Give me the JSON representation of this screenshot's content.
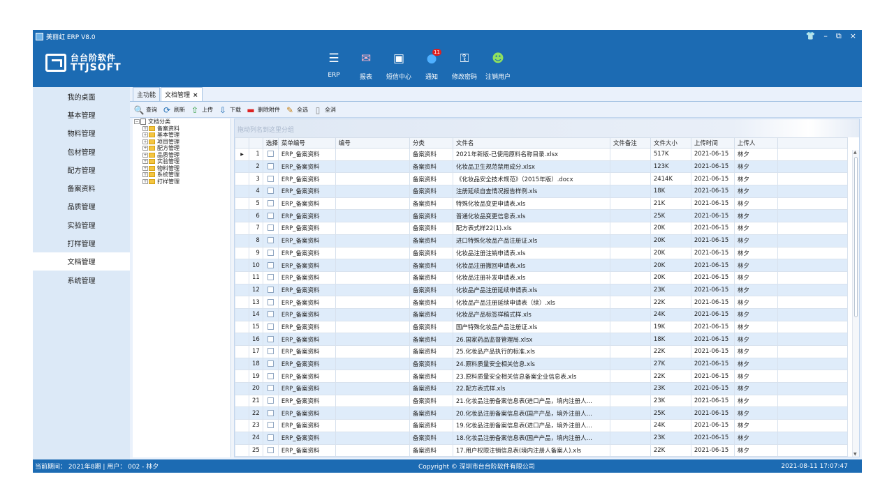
{
  "window": {
    "title": "美丽虹 ERP V8.0"
  },
  "logo": {
    "cn": "台台阶软件",
    "en": "TTJSOFT"
  },
  "topnav": [
    {
      "label": "ERP",
      "icon": "erp-icon"
    },
    {
      "label": "报表",
      "icon": "report-icon"
    },
    {
      "label": "短信中心",
      "icon": "sms-icon"
    },
    {
      "label": "通知",
      "icon": "notification-icon",
      "badge": "11"
    },
    {
      "label": "修改密码",
      "icon": "key-icon"
    },
    {
      "label": "注销用户",
      "icon": "logout-user-icon"
    }
  ],
  "sidebar": [
    "我的桌面",
    "基本管理",
    "物料管理",
    "包材管理",
    "配方管理",
    "备案资料",
    "品质管理",
    "实验管理",
    "打样管理",
    "文档管理",
    "系统管理"
  ],
  "sidebar_active": "文档管理",
  "tabs": {
    "main": "主功能",
    "doc": "文档管理",
    "close": "×"
  },
  "toolbar": {
    "query": "查询",
    "refresh": "刷新",
    "upload": "上传",
    "download": "下载",
    "delete": "删除附件",
    "selectall": "全选",
    "deselect": "全消"
  },
  "tree": {
    "root": "文档分类",
    "children": [
      "备案资料",
      "基本管理",
      "项目管理",
      "配方管理",
      "品质管理",
      "实验管理",
      "物料管理",
      "系统管理",
      "打样管理"
    ]
  },
  "grid": {
    "group_hint": "拖动列名到这里分组",
    "headers": [
      "选择",
      "菜单编号",
      "编号",
      "分类",
      "文件名",
      "文件备注",
      "文件大小",
      "上传时间",
      "上传人"
    ],
    "rows": [
      {
        "n": "1",
        "menu": "ERP_备案资料",
        "code": "",
        "cat": "备案资料",
        "file": "2021年新版-已使用原料名称目录.xlsx",
        "note": "",
        "size": "517K",
        "date": "2021-06-15",
        "user": "林夕"
      },
      {
        "n": "2",
        "menu": "ERP_备案资料",
        "code": "",
        "cat": "备案资料",
        "file": "化妆品卫生规范禁用成分.xlsx",
        "note": "",
        "size": "123K",
        "date": "2021-06-15",
        "user": "林夕"
      },
      {
        "n": "3",
        "menu": "ERP_备案资料",
        "code": "",
        "cat": "备案资料",
        "file": "《化妆品安全技术规范》（2015年版）.docx",
        "note": "",
        "size": "2414K",
        "date": "2021-06-15",
        "user": "林夕"
      },
      {
        "n": "4",
        "menu": "ERP_备案资料",
        "code": "",
        "cat": "备案资料",
        "file": "注册延续自查情况报告样例.xls",
        "note": "",
        "size": "18K",
        "date": "2021-06-15",
        "user": "林夕"
      },
      {
        "n": "5",
        "menu": "ERP_备案资料",
        "code": "",
        "cat": "备案资料",
        "file": "特殊化妆品变更申请表.xls",
        "note": "",
        "size": "21K",
        "date": "2021-06-15",
        "user": "林夕"
      },
      {
        "n": "6",
        "menu": "ERP_备案资料",
        "code": "",
        "cat": "备案资料",
        "file": "普通化妆品变更信息表.xls",
        "note": "",
        "size": "25K",
        "date": "2021-06-15",
        "user": "林夕"
      },
      {
        "n": "7",
        "menu": "ERP_备案资料",
        "code": "",
        "cat": "备案资料",
        "file": "配方表式样22(1).xls",
        "note": "",
        "size": "20K",
        "date": "2021-06-15",
        "user": "林夕"
      },
      {
        "n": "8",
        "menu": "ERP_备案资料",
        "code": "",
        "cat": "备案资料",
        "file": "进口特殊化妆品产品注册证.xls",
        "note": "",
        "size": "20K",
        "date": "2021-06-15",
        "user": "林夕"
      },
      {
        "n": "9",
        "menu": "ERP_备案资料",
        "code": "",
        "cat": "备案资料",
        "file": "化妆品注册注销申请表.xls",
        "note": "",
        "size": "20K",
        "date": "2021-06-15",
        "user": "林夕"
      },
      {
        "n": "10",
        "menu": "ERP_备案资料",
        "code": "",
        "cat": "备案资料",
        "file": "化妆品注册撤回申请表.xls",
        "note": "",
        "size": "20K",
        "date": "2021-06-15",
        "user": "林夕"
      },
      {
        "n": "11",
        "menu": "ERP_备案资料",
        "code": "",
        "cat": "备案资料",
        "file": "化妆品注册补发申请表.xls",
        "note": "",
        "size": "20K",
        "date": "2021-06-15",
        "user": "林夕"
      },
      {
        "n": "12",
        "menu": "ERP_备案资料",
        "code": "",
        "cat": "备案资料",
        "file": "化妆品产品注册延续申请表.xls",
        "note": "",
        "size": "23K",
        "date": "2021-06-15",
        "user": "林夕"
      },
      {
        "n": "13",
        "menu": "ERP_备案资料",
        "code": "",
        "cat": "备案资料",
        "file": "化妆品产品注册延续申请表（续）.xls",
        "note": "",
        "size": "22K",
        "date": "2021-06-15",
        "user": "林夕"
      },
      {
        "n": "14",
        "menu": "ERP_备案资料",
        "code": "",
        "cat": "备案资料",
        "file": "化妆品产品标签样稿式样.xls",
        "note": "",
        "size": "24K",
        "date": "2021-06-15",
        "user": "林夕"
      },
      {
        "n": "15",
        "menu": "ERP_备案资料",
        "code": "",
        "cat": "备案资料",
        "file": "国产特殊化妆品产品注册证.xls",
        "note": "",
        "size": "19K",
        "date": "2021-06-15",
        "user": "林夕"
      },
      {
        "n": "16",
        "menu": "ERP_备案资料",
        "code": "",
        "cat": "备案资料",
        "file": "26.国家药品监督管理局.xlsx",
        "note": "",
        "size": "18K",
        "date": "2021-06-15",
        "user": "林夕"
      },
      {
        "n": "17",
        "menu": "ERP_备案资料",
        "code": "",
        "cat": "备案资料",
        "file": "25.化妆品产品执行的标准.xls",
        "note": "",
        "size": "22K",
        "date": "2021-06-15",
        "user": "林夕"
      },
      {
        "n": "18",
        "menu": "ERP_备案资料",
        "code": "",
        "cat": "备案资料",
        "file": "24.原料质量安全相关信息.xls",
        "note": "",
        "size": "27K",
        "date": "2021-06-15",
        "user": "林夕"
      },
      {
        "n": "19",
        "menu": "ERP_备案资料",
        "code": "",
        "cat": "备案资料",
        "file": "23.原料质量安全相关信息备案企业信息表.xls",
        "note": "",
        "size": "22K",
        "date": "2021-06-15",
        "user": "林夕"
      },
      {
        "n": "20",
        "menu": "ERP_备案资料",
        "code": "",
        "cat": "备案资料",
        "file": "22.配方表式样.xls",
        "note": "",
        "size": "23K",
        "date": "2021-06-15",
        "user": "林夕"
      },
      {
        "n": "21",
        "menu": "ERP_备案资料",
        "code": "",
        "cat": "备案资料",
        "file": "21.化妆品注册备案信息表(进口产品，境内注册人...",
        "note": "",
        "size": "23K",
        "date": "2021-06-15",
        "user": "林夕"
      },
      {
        "n": "22",
        "menu": "ERP_备案资料",
        "code": "",
        "cat": "备案资料",
        "file": "20.化妆品注册备案信息表(国产产品，境外注册人...",
        "note": "",
        "size": "25K",
        "date": "2021-06-15",
        "user": "林夕"
      },
      {
        "n": "23",
        "menu": "ERP_备案资料",
        "code": "",
        "cat": "备案资料",
        "file": "19.化妆品注册备案信息表(进口产品，境外注册人...",
        "note": "",
        "size": "24K",
        "date": "2021-06-15",
        "user": "林夕"
      },
      {
        "n": "24",
        "menu": "ERP_备案资料",
        "code": "",
        "cat": "备案资料",
        "file": "18.化妆品注册备案信息表(国产产品，境内注册人...",
        "note": "",
        "size": "23K",
        "date": "2021-06-15",
        "user": "林夕"
      },
      {
        "n": "25",
        "menu": "ERP_备案资料",
        "code": "",
        "cat": "备案资料",
        "file": "17.用户权限注销信息表(境内注册人备案人).xls",
        "note": "",
        "size": "22K",
        "date": "2021-06-15",
        "user": "林夕"
      }
    ]
  },
  "status": {
    "period": "当前期间：  2021年8期  |  用户：  002 - 林夕",
    "copyright": "Copyright © 深圳市台台阶软件有限公司",
    "datetime": "2021-08-11 17:07:47"
  },
  "colors": {
    "brand": "#1c6bb3",
    "sidebar": "#dce9f7",
    "row_alt": "#dfecfa"
  }
}
